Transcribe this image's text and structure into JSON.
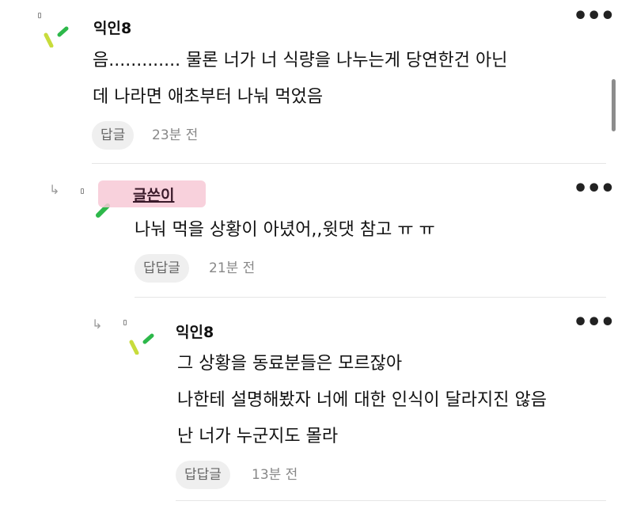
{
  "comments": [
    {
      "nickname": "익인8",
      "lines": [
        "음............. 물론 너가 너 식량을 나누는게 당연한건 아닌",
        "데 나라면 애초부터 나눠 먹었음"
      ],
      "button": "답글",
      "time": "23분 전"
    },
    {
      "nickname": "글쓴이",
      "lines": [
        "나눠 먹을 상황이 아녔어,,윗댓 참고 ㅠ ㅠ"
      ],
      "button": "답답글",
      "time": "21분 전"
    },
    {
      "nickname": "익인8",
      "lines": [
        "그 상황을 동료분들은 모르잖아",
        "나한테 설명해봤자 너에 대한 인식이 달라지진 않음",
        "난 너가 누군지도 몰라"
      ],
      "button": "답답글",
      "time": "13분 전"
    }
  ],
  "more_glyph": "•••",
  "reply_glyph": "↳",
  "colors": {
    "avatar_green": "#2db84a",
    "avatar_yellow": "#c8dc3c",
    "highlight": "#f7c9d6"
  },
  "icons": [
    "more-options-icon",
    "reply-arrow-icon",
    "avatar-icon"
  ]
}
